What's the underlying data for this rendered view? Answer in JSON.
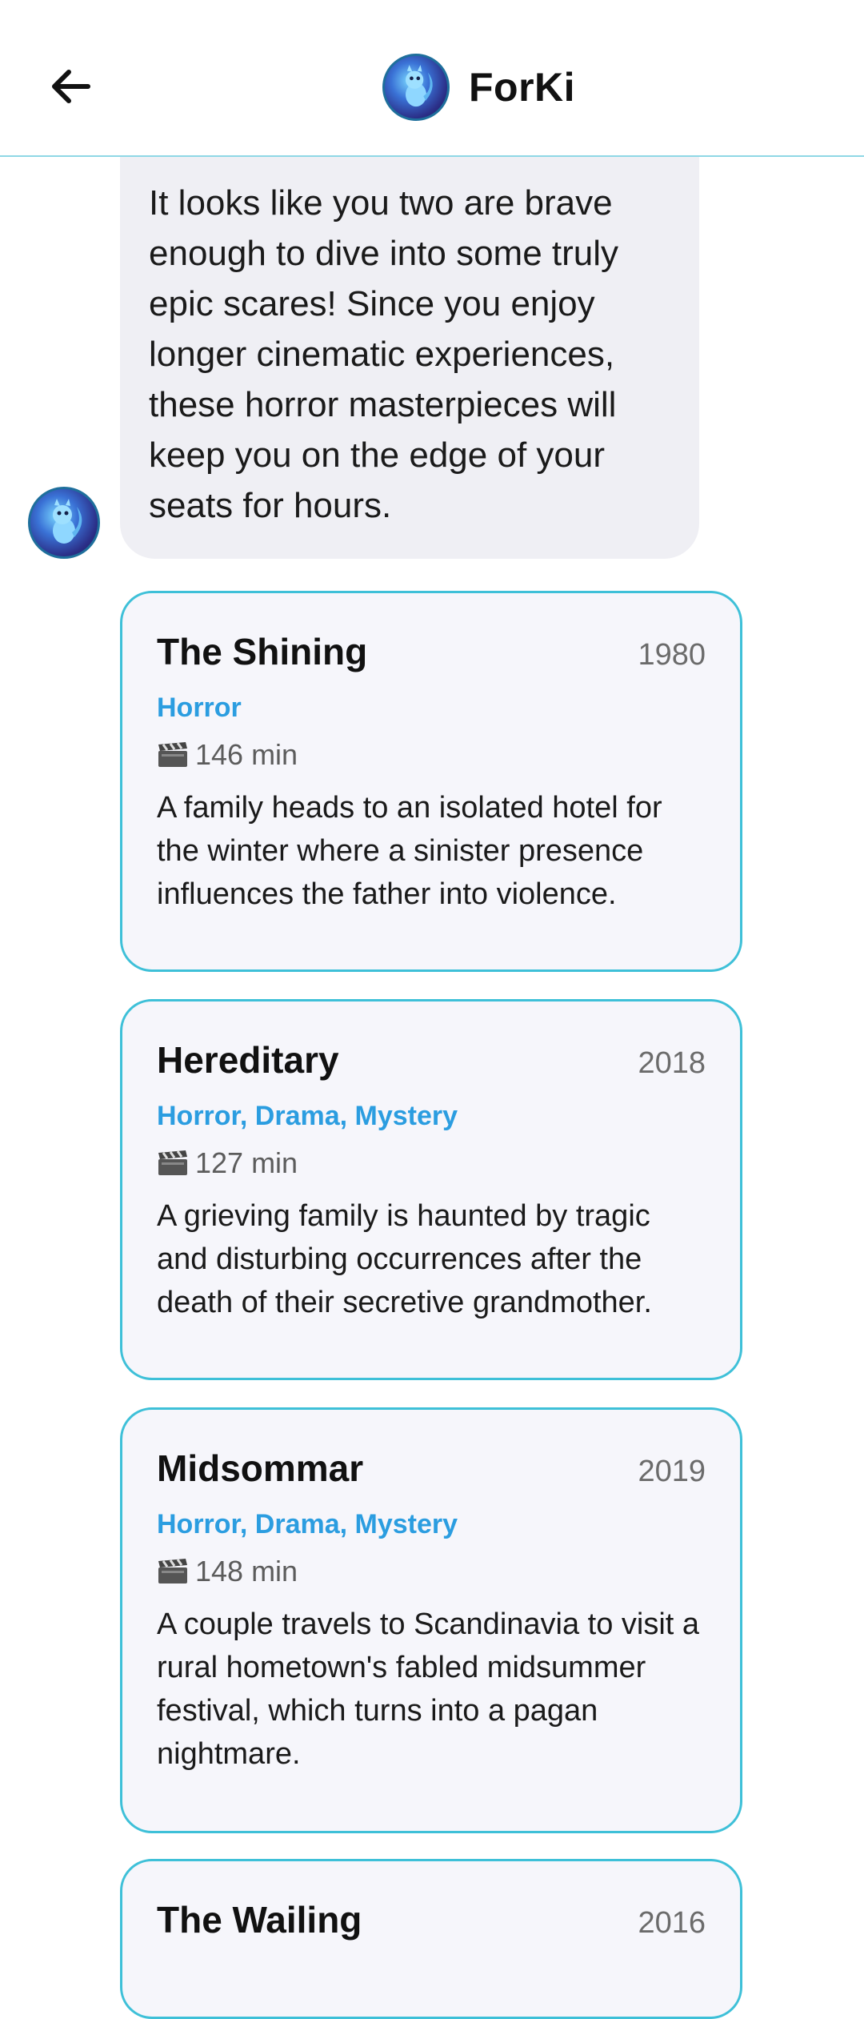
{
  "header": {
    "title": "ForKi",
    "back_icon": "arrow-left-icon",
    "avatar_icon": "squirrel-avatar-icon"
  },
  "message": {
    "text": "It looks like you two are brave enough to dive into some truly epic scares! Since you enjoy longer cinematic experiences, these horror masterpieces will keep you on the edge of your seats for hours."
  },
  "movies": [
    {
      "title": "The Shining",
      "year": "1980",
      "genre": "Horror",
      "duration": "146 min",
      "description": "A family heads to an isolated hotel for the winter where a sinister presence influences the father into violence."
    },
    {
      "title": "Hereditary",
      "year": "2018",
      "genre": "Horror, Drama, Mystery",
      "duration": "127 min",
      "description": "A grieving family is haunted by tragic and disturbing occurrences after the death of their secretive grandmother."
    },
    {
      "title": "Midsommar",
      "year": "2019",
      "genre": "Horror, Drama, Mystery",
      "duration": "148 min",
      "description": "A couple travels to Scandinavia to visit a rural hometown's fabled midsummer festival, which turns into a pagan nightmare."
    },
    {
      "title": "The Wailing",
      "year": "2016"
    }
  ],
  "colors": {
    "accent": "#3ec0d8",
    "genre": "#2b9de0",
    "card_bg": "#f6f6fb",
    "bubble_bg": "#efeff4"
  }
}
